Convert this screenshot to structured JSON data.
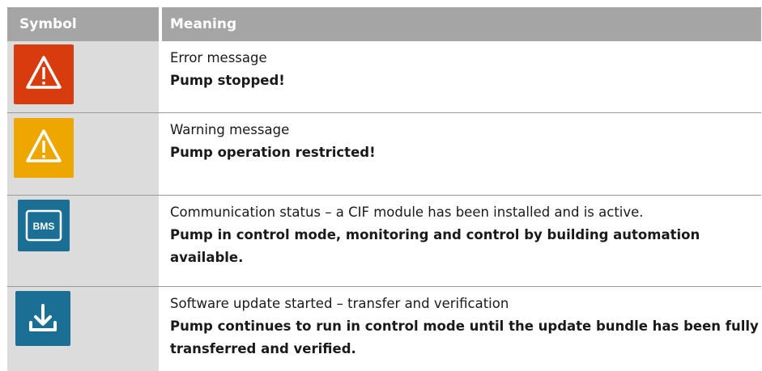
{
  "table": {
    "headers": {
      "symbol": "Symbol",
      "meaning": "Meaning"
    },
    "rows": [
      {
        "icon": "error-warning-triangle-icon",
        "color": "#d83b0e",
        "line1": "Error message",
        "line2": "Pump stopped!"
      },
      {
        "icon": "warning-triangle-icon",
        "color": "#eea600",
        "line1": "Warning message",
        "line2": "Pump operation restricted!"
      },
      {
        "icon": "bms-icon",
        "color": "#1b6f94",
        "label": "BMS",
        "line1": "Communication status – a CIF module has been installed and is active.",
        "line2": "Pump in control mode, monitoring and control by building automation available."
      },
      {
        "icon": "download-icon",
        "color": "#1b6f94",
        "line1": "Software update started – transfer and verification",
        "line2": "Pump continues to run in control mode until the update bundle has been fully transferred and verified."
      }
    ]
  }
}
